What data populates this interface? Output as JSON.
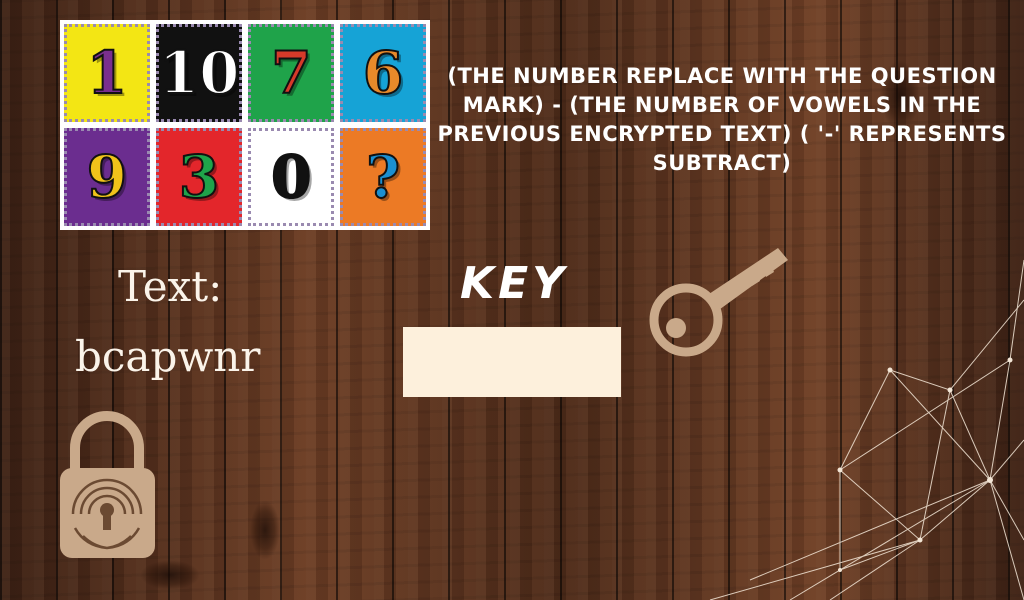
{
  "puzzle": {
    "tiles": [
      {
        "label": "1",
        "bg": "#f3e614",
        "fg": "#7a2f8e"
      },
      {
        "label": "10",
        "bg": "#111111",
        "fg": "#ffffff"
      },
      {
        "label": "7",
        "bg": "#1fa34a",
        "fg": "#d63a2a"
      },
      {
        "label": "6",
        "bg": "#16a3d6",
        "fg": "#e88a2a"
      },
      {
        "label": "9",
        "bg": "#6b2d8f",
        "fg": "#f0c21a"
      },
      {
        "label": "3",
        "bg": "#e3262b",
        "fg": "#1fa34a"
      },
      {
        "label": "0",
        "bg": "#ffffff",
        "fg": "#111111"
      },
      {
        "label": "?",
        "bg": "#ec7a25",
        "fg": "#1b8fd0"
      }
    ]
  },
  "rule_text": "(The number replace with the question mark) - (The number of vowels in the previous encrypted text) ( '-' represents subtract)",
  "text_label": "Text:",
  "cipher_text": "bcapwnr",
  "key_label": "KEY",
  "key_input": {
    "value": "",
    "placeholder": ""
  },
  "colors": {
    "text": "#fbf4ea",
    "input_bg": "#fdf0dc",
    "icon": "#c9a98a"
  },
  "icons": [
    "key-icon",
    "padlock-icon",
    "network-lines-decoration"
  ]
}
